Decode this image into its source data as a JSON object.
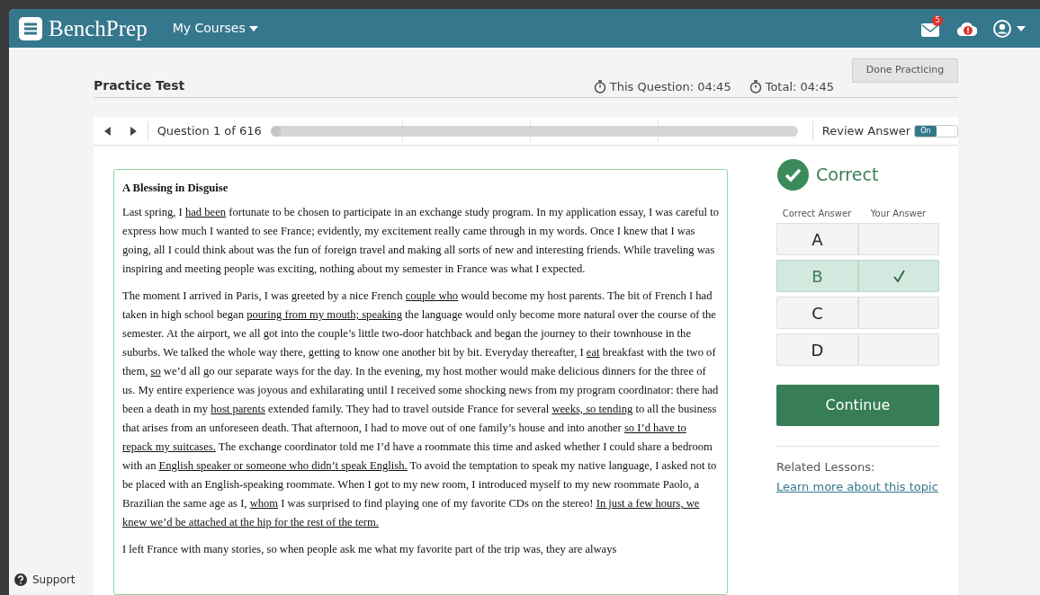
{
  "navbar": {
    "brand": "BenchPrep",
    "menu": "My Courses",
    "mail_badge": "5"
  },
  "header": {
    "title": "Practice Test",
    "question_timer": "This Question: 04:45",
    "total_timer": "Total: 04:45",
    "done_button": "Done Practicing"
  },
  "toolbar": {
    "question_label": "Question 1 of 616",
    "progress": {
      "level": 0
    },
    "review_label": "Review Answer",
    "review_toggle": {
      "on": true,
      "label": "On"
    }
  },
  "passage": {
    "title": "A Blessing in Disguise",
    "paragraphs": [
      [
        {
          "text": "Last spring, I ",
          "underlined": false
        },
        {
          "text": "had been",
          "underlined": true
        },
        {
          "text": " fortunate to be chosen to participate in an exchange study program. In my application essay, I was careful to express how much I wanted to see France; evidently, my excitement really came through in my words. Once I knew that I was going, all I could think about was the fun of foreign travel and making all sorts of new and interesting friends. While traveling was inspiring and meeting people was exciting, nothing about my semester in France was what I expected.",
          "underlined": false
        }
      ],
      [
        {
          "text": "The moment I arrived in Paris, I was greeted by a nice French ",
          "underlined": false
        },
        {
          "text": "couple who",
          "underlined": true
        },
        {
          "text": " would become my host parents. The bit of French I had taken in high school began ",
          "underlined": false
        },
        {
          "text": "pouring from my mouth; speaking",
          "underlined": true
        },
        {
          "text": " the language would only become more natural over the course of the semester. At the airport, we all got into the couple’s little two-door hatchback and began the journey to their townhouse in the suburbs. We talked the whole way there, getting to know one another bit by bit. Everyday thereafter, I ",
          "underlined": false
        },
        {
          "text": "eat",
          "underlined": true
        },
        {
          "text": " breakfast with the two of them, ",
          "underlined": false
        },
        {
          "text": "so",
          "underlined": true
        },
        {
          "text": " we’d all go our separate ways for the day. In the evening, my host mother would make delicious dinners for the three of us. My entire experience was joyous and exhilarating until I received some shocking news from my program coordinator: there had been a death in my ",
          "underlined": false
        },
        {
          "text": "host parents",
          "underlined": true
        },
        {
          "text": " extended family. They had to travel outside France for several ",
          "underlined": false
        },
        {
          "text": "weeks, so tending",
          "underlined": true
        },
        {
          "text": " to all the business that arises from an unforeseen death. That afternoon, I had to move out of one family’s house and into another ",
          "underlined": false
        },
        {
          "text": "so I’d have to repack my suitcases.",
          "underlined": true
        },
        {
          "text": " The exchange coordinator told me I’d have a roommate this time and asked whether I could share a bedroom with an ",
          "underlined": false
        },
        {
          "text": "English speaker or someone who didn’t speak English.",
          "underlined": true
        },
        {
          "text": " To avoid the temptation to speak my native language, I asked not to be placed with an English-speaking roommate. When I got to my new room, I introduced myself to my new roommate Paolo, a Brazilian the same age as I, ",
          "underlined": false
        },
        {
          "text": "whom",
          "underlined": true
        },
        {
          "text": " I was surprised to find playing one of my favorite CDs on the stereo! ",
          "underlined": false
        },
        {
          "text": "In just a few hours, we knew we’d be attached at the hip for the rest of the term.",
          "underlined": true
        }
      ],
      [
        {
          "text": "I left France with many stories, so when people ask me what my favorite part of the trip was, they are always",
          "underlined": false
        }
      ]
    ]
  },
  "result": {
    "status": "Correct",
    "correct": true,
    "col_correct": "Correct Answer",
    "col_yours": "Your Answer",
    "answers": [
      {
        "letter": "A",
        "correct": false,
        "chosen": false
      },
      {
        "letter": "B",
        "correct": true,
        "chosen": true
      },
      {
        "letter": "C",
        "correct": false,
        "chosen": false
      },
      {
        "letter": "D",
        "correct": false,
        "chosen": false
      }
    ],
    "continue_button": "Continue",
    "related_label": "Related Lessons:",
    "related_link": "Learn more about this topic"
  },
  "support": "Support"
}
